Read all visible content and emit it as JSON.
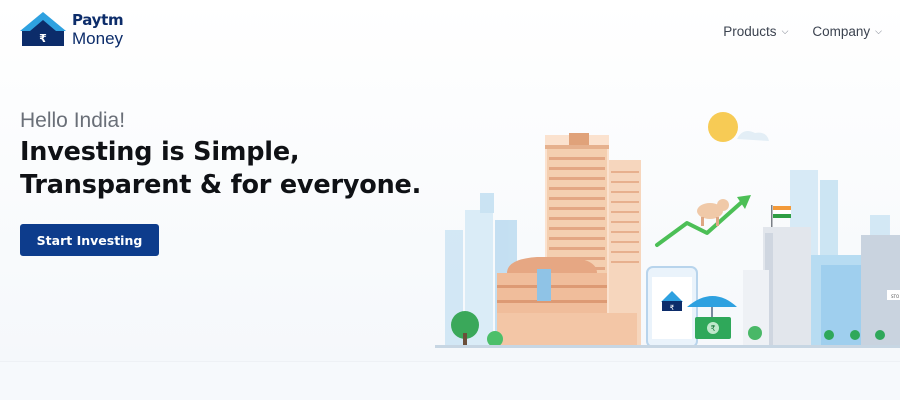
{
  "brand": {
    "name_top": "Paytm",
    "name_bottom": "Money",
    "mark_symbol": "₹",
    "colors": {
      "primary": "#0d3c8c",
      "accent": "#2ea1e0"
    }
  },
  "nav": {
    "items": [
      {
        "label": "Products"
      },
      {
        "label": "Company"
      }
    ],
    "chevron_glyph": "⌵"
  },
  "hero": {
    "greeting": "Hello India!",
    "headline_line1": "Investing is Simple,",
    "headline_line2": "Transparent & for everyone.",
    "cta_label": "Start Investing"
  },
  "illustration": {
    "phone_symbol": "₹",
    "banknote_symbol": "₹",
    "building_sign": "STO",
    "icons": [
      "sun-icon",
      "bull-icon",
      "trend-arrow-icon",
      "india-flag-icon",
      "umbrella-icon",
      "banknote-icon",
      "phone-icon"
    ]
  }
}
